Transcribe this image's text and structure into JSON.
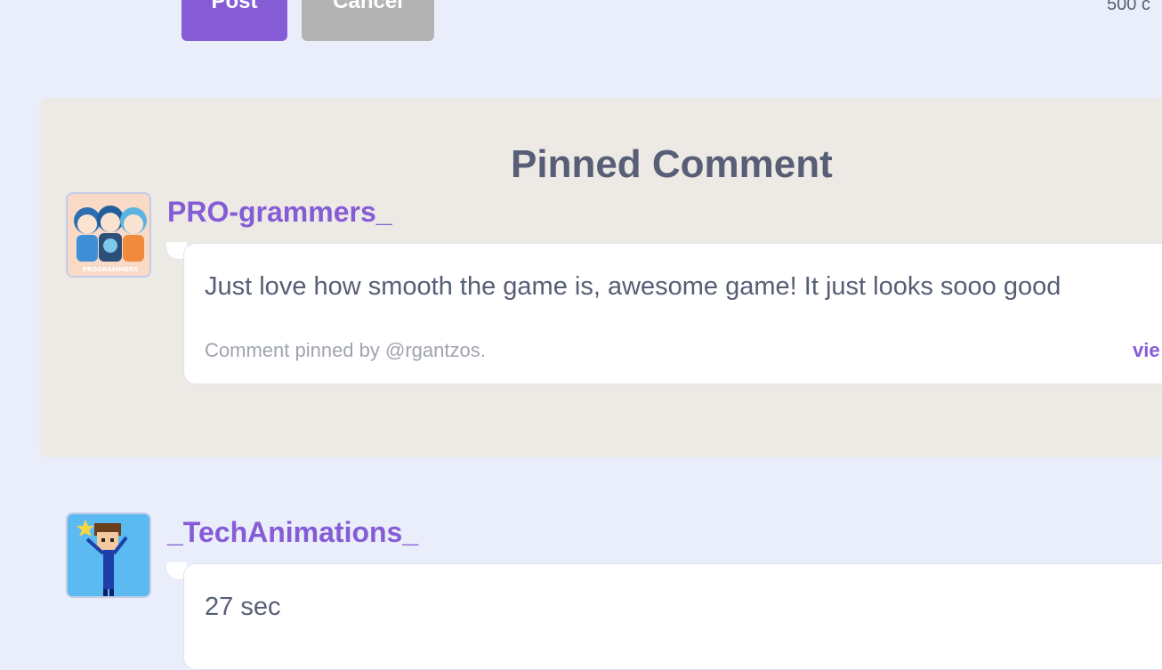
{
  "composer": {
    "post_label": "Post",
    "cancel_label": "Cancel",
    "char_count": "500 c"
  },
  "pinned": {
    "title": "Pinned Comment",
    "comment": {
      "username": "PRO-grammers_",
      "text": "Just love how smooth the game is, awesome game! It just looks sooo good",
      "pinned_note": "Comment pinned by @rgantzos.",
      "view_link": "vie"
    }
  },
  "comments": [
    {
      "username": "_TechAnimations_",
      "text": "27 sec"
    }
  ],
  "colors": {
    "accent": "#855cd6",
    "background": "#e9eefa",
    "pinned_bg": "#ede9e5",
    "text": "#575e75",
    "muted": "#a0a4b0",
    "cancel": "#b3b3b3"
  }
}
